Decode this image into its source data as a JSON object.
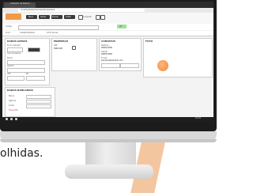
{
  "caption": "olhidas.",
  "browser": {
    "tab_title": "Cadastro de Pessoa",
    "url": "localhost/sistema/cadastro/pessoa"
  },
  "toolbar": {
    "buttons": [
      "Novo",
      "Salvar",
      "Excluir",
      "Voltar"
    ],
    "consultar_label": "Consultar"
  },
  "nav": {
    "items": [
      "Inicio",
      "Cadastro/Pessoa",
      "Informacoes"
    ]
  },
  "form": {
    "filter_label": "Codigo",
    "go_label": "Ok",
    "panels": {
      "dados_gerais": "DADOS GERAIS",
      "endereco": "ENDEREÇO",
      "contatos": "CONTATOS",
      "foto": "FOTO",
      "dados_bancarios": "DADOS BANCÁRIOS"
    },
    "fields": {
      "codigo_label": "Nº do cadastro",
      "tipo_label": "Tipo de pessoa",
      "nome_label": "Nome",
      "apelido_label": "Apelido",
      "cpf_label": "CPF",
      "rg_label": "RG",
      "cep_label": "CEP",
      "cep_value": "0000-000",
      "telefone_label": "Telefone",
      "telefone_value": "00000-0000",
      "celular_label": "Celular",
      "celular_value": "00000-0000",
      "email_label": "E-mail",
      "email_value": "exemplo@exemplo.com",
      "banco_label": "Banco",
      "agencia_label": "Agência",
      "conta_label": "Conta",
      "pix_label": "Chave PIX"
    }
  },
  "taskbar": {
    "time": "10:24"
  },
  "colors": {
    "accent": "#f29a4a",
    "go_button": "#9ee29a",
    "stand_stripe": "#f4c69f"
  }
}
